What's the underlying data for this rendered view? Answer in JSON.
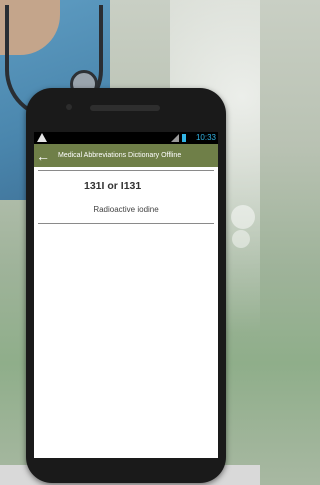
{
  "status_bar": {
    "time": "10:33",
    "warning_icon": "warning-icon",
    "signal_icon": "signal-icon",
    "battery_icon": "battery-icon",
    "time_color": "#33b5e5"
  },
  "app_bar": {
    "title": "Medical Abbreviations Dictionary Offline",
    "back_icon": "back-arrow-icon",
    "color": "#6f7f48"
  },
  "entry": {
    "abbreviation": "131I or I131",
    "meaning": "Radioactive iodine"
  }
}
